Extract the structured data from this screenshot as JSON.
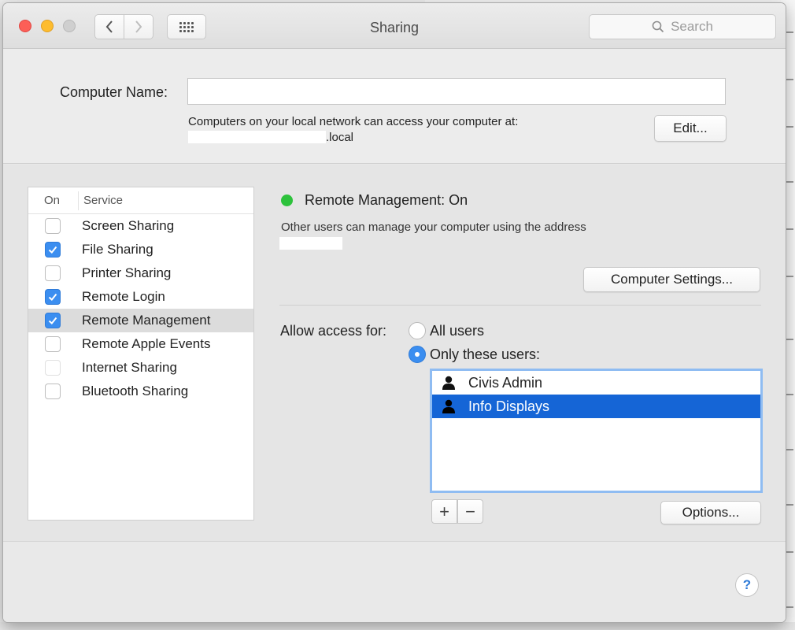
{
  "window": {
    "title": "Sharing",
    "search_placeholder": "Search"
  },
  "computer_name": {
    "label": "Computer Name:",
    "value": "",
    "description": "Computers on your local network can access your computer at:",
    "host_suffix": ".local",
    "edit_label": "Edit..."
  },
  "services": {
    "header_on": "On",
    "header_service": "Service",
    "items": [
      {
        "label": "Screen Sharing",
        "checked": false,
        "selected": false
      },
      {
        "label": "File Sharing",
        "checked": true,
        "selected": false
      },
      {
        "label": "Printer Sharing",
        "checked": false,
        "selected": false
      },
      {
        "label": "Remote Login",
        "checked": true,
        "selected": false
      },
      {
        "label": "Remote Management",
        "checked": true,
        "selected": true
      },
      {
        "label": "Remote Apple Events",
        "checked": false,
        "selected": false
      },
      {
        "label": "Internet Sharing",
        "checked": false,
        "selected": false
      },
      {
        "label": "Bluetooth Sharing",
        "checked": false,
        "selected": false
      }
    ]
  },
  "remote_management": {
    "status": "Remote Management: On",
    "status_color": "#2dc23c",
    "description": "Other users can manage your computer using the address",
    "computer_settings_label": "Computer Settings...",
    "allow_access_label": "Allow access for:",
    "all_users_label": "All users",
    "only_these_users_label": "Only these users:",
    "selected_access": "only_these_users",
    "users": [
      {
        "name": "Civis Admin",
        "selected": false
      },
      {
        "name": "Info Displays",
        "selected": true
      }
    ],
    "add_label": "+",
    "remove_label": "−",
    "options_label": "Options..."
  },
  "help_label": "?",
  "colors": {
    "accent": "#3b8ef0",
    "selection": "#1565d6"
  }
}
